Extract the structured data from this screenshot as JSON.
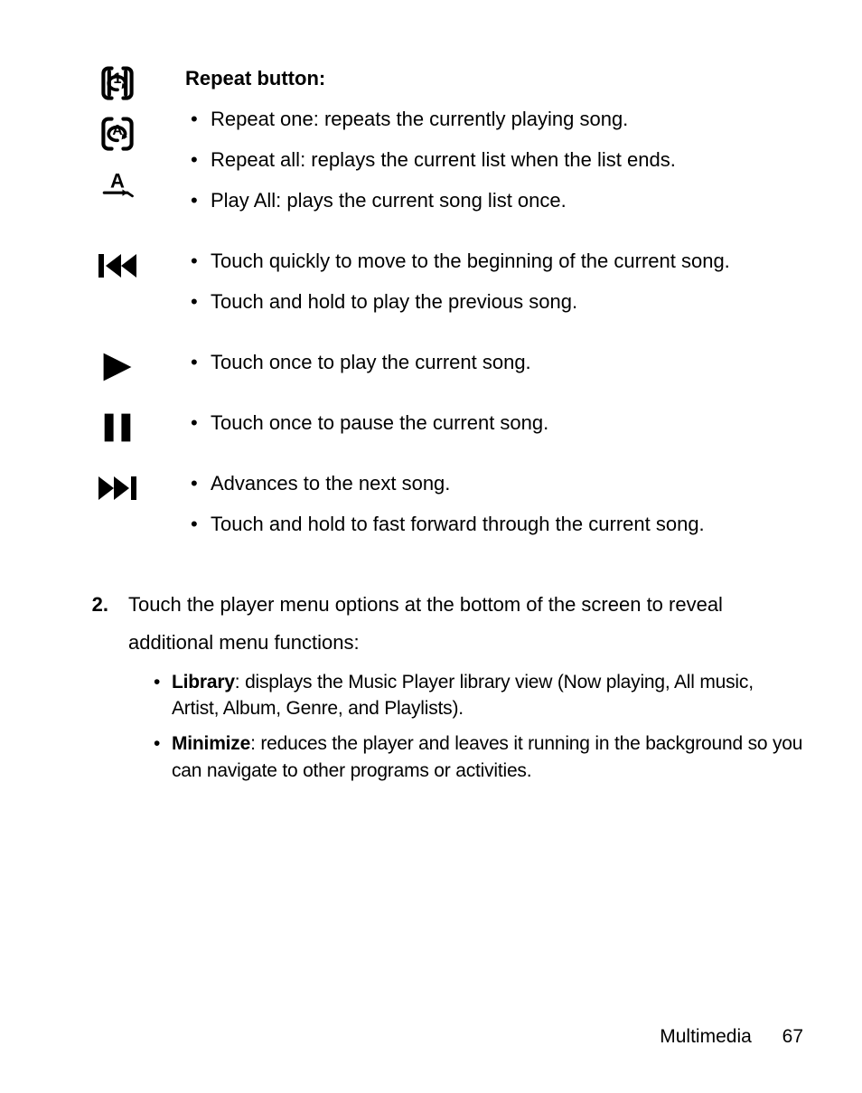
{
  "sections": {
    "repeat": {
      "heading": "Repeat button:",
      "items": [
        "Repeat one: repeats the currently playing song.",
        "Repeat all: replays the current list when the list ends.",
        "Play All: plays the current song list once."
      ]
    },
    "prev": {
      "items": [
        "Touch quickly to move to the beginning of the current song.",
        "Touch and hold to play the previous song."
      ]
    },
    "play": {
      "items": [
        "Touch once to play the current song."
      ]
    },
    "pause": {
      "items": [
        "Touch once to pause the current song."
      ]
    },
    "next": {
      "items": [
        "Advances to the next song.",
        "Touch and hold to fast forward through the current song."
      ]
    }
  },
  "step2": {
    "number": "2.",
    "text": "Touch the player menu options at the bottom of the screen to reveal additional menu functions:",
    "items": [
      {
        "key": "Library",
        "desc": ": displays the Music Player library view (Now playing, All music, Artist, Album, Genre, and Playlists)."
      },
      {
        "key": "Minimize",
        "desc": ": reduces the player and leaves it running in the background so you can navigate to other programs or activities."
      }
    ]
  },
  "footer": {
    "section": "Multimedia",
    "page": "67"
  }
}
